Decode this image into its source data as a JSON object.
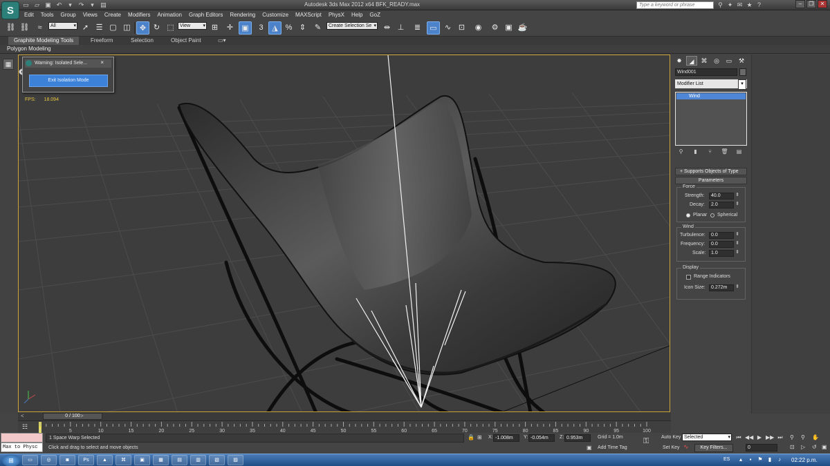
{
  "window": {
    "title": "Autodesk 3ds Max  2012 x64     BFK_READY.max",
    "search_placeholder": "Type a keyword or phrase"
  },
  "app_logo": "S",
  "menu": [
    "Edit",
    "Tools",
    "Group",
    "Views",
    "Create",
    "Modifiers",
    "Animation",
    "Graph Editors",
    "Rendering",
    "Customize",
    "MAXScript",
    "PhysX",
    "Help",
    "GoZ"
  ],
  "toolbar": {
    "filter_value": "All",
    "refcoord_value": "View",
    "named_selection_placeholder": "Create Selection Se",
    "snap_label": "3",
    "snap_angle_label": "2",
    "percent_snap_label": "%"
  },
  "ribbon": {
    "tabs": [
      "Graphite Modeling Tools",
      "Freeform",
      "Selection",
      "Object Paint"
    ],
    "subtab": "Polygon Modeling"
  },
  "dialog": {
    "title": "Warning: Isolated Sele...",
    "close": "×",
    "button": "Exit Isolation Mode"
  },
  "viewport": {
    "fps_label": "FPS:",
    "fps_value": "18.094"
  },
  "command_panel": {
    "object_name": "Wind001",
    "modifier_list": "Modifier List",
    "stack_items": [
      "Wind"
    ],
    "rollout_supports": "Supports Objects of Type",
    "rollout_parameters": "Parameters",
    "force": {
      "group": "Force",
      "strength_label": "Strength:",
      "strength_value": "40.0",
      "decay_label": "Decay:",
      "decay_value": "2.0",
      "planar_label": "Planar",
      "spherical_label": "Spherical",
      "planar_selected": true
    },
    "wind": {
      "group": "Wind",
      "turbulence_label": "Turbulence:",
      "turbulence_value": "0.0",
      "frequency_label": "Frequency:",
      "frequency_value": "0.0",
      "scale_label": "Scale:",
      "scale_value": "1.0"
    },
    "display": {
      "group": "Display",
      "range_label": "Range Indicators",
      "range_checked": false,
      "iconsize_label": "Icon Size:",
      "iconsize_value": "0.272m"
    }
  },
  "timeline": {
    "slider": "0 / 100",
    "ticks": [
      "0",
      "5",
      "10",
      "15",
      "20",
      "25",
      "30",
      "35",
      "40",
      "45",
      "50",
      "55",
      "60",
      "65",
      "70",
      "75",
      "80",
      "85",
      "90",
      "95",
      "100"
    ]
  },
  "status": {
    "maxscript": "Max to Physc",
    "selection": "1 Space Warp Selected",
    "prompt": "Click and drag to select and move objects",
    "x_label": "X:",
    "x_value": "-1.008m",
    "y_label": "Y:",
    "y_value": "-0.054m",
    "z_label": "Z:",
    "z_value": "0.953m",
    "grid": "Grid = 1.0m",
    "add_time_tag": "Add Time Tag",
    "auto_key": "Auto Key",
    "set_key": "Set Key",
    "selected_dd": "Selected",
    "key_filters": "Key Filters...",
    "frame_value": "0"
  },
  "taskbar": {
    "language": "ES",
    "clock": "02:22 p.m."
  },
  "colors": {
    "viewport_bg": "#3d3d3d",
    "active_border": "#c8a43a",
    "selection_blue": "#4f86d6",
    "fps_yellow": "#e8c441"
  }
}
